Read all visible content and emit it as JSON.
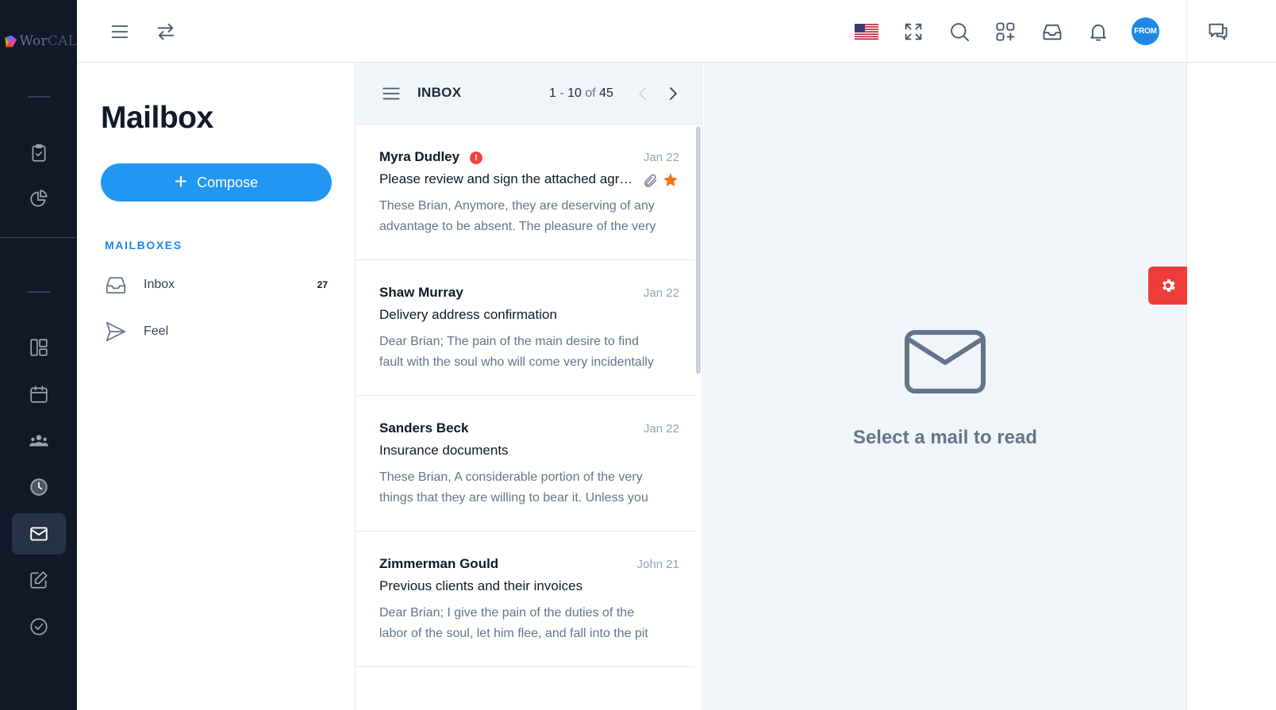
{
  "brand": {
    "logo_text_a": "Wor",
    "logo_text_b": "CAL"
  },
  "topbar": {
    "avatar_label": "FROM",
    "flag": "us-flag",
    "icons": [
      "menu-icon",
      "swap-icon",
      "fullscreen-icon",
      "search-icon",
      "apps-icon",
      "tray-icon",
      "bell-icon",
      "chat-icon"
    ]
  },
  "mailbox": {
    "title": "Mailbox",
    "compose_label": "Compose",
    "section_label": "MAILBOXES",
    "items": [
      {
        "label": "Inbox",
        "count": "27"
      },
      {
        "label": "Feel",
        "count": ""
      }
    ]
  },
  "list": {
    "title": "INBOX",
    "range_a": "1",
    "range_sep": " - ",
    "range_b": "10",
    "of_label": " of ",
    "total": "45",
    "mails": [
      {
        "from": "Myra Dudley",
        "date": "Jan 22",
        "subject": "Please review and sign the attached agreement",
        "preview_1": "These Brian, Anymore, they are deserving of any",
        "preview_2": "advantage to be absent. The pleasure of the very",
        "important": "!"
      },
      {
        "from": "Shaw Murray",
        "date": "Jan 22",
        "subject": "Delivery address confirmation",
        "preview_1": "Dear Brian; The pain of the main desire to find",
        "preview_2": "fault with the soul who will come very incidentally"
      },
      {
        "from": "Sanders Beck",
        "date": "Jan 22",
        "subject": "Insurance documents",
        "preview_1": "These Brian, A considerable portion of the very",
        "preview_2": "things that they are willing to bear it. Unless you"
      },
      {
        "from": "Zimmerman Gould",
        "date": "John 21",
        "subject": "Previous clients and their invoices",
        "preview_1": "Dear Brian; I give the pain of the duties of the",
        "preview_2": "labor of the soul, let him flee, and fall into the pit"
      }
    ]
  },
  "reader": {
    "empty_message": "Select a mail to read"
  },
  "colors": {
    "sidebar": "#111827",
    "accent": "#2196f3",
    "danger": "#ef3b3b",
    "star": "#f97316"
  }
}
